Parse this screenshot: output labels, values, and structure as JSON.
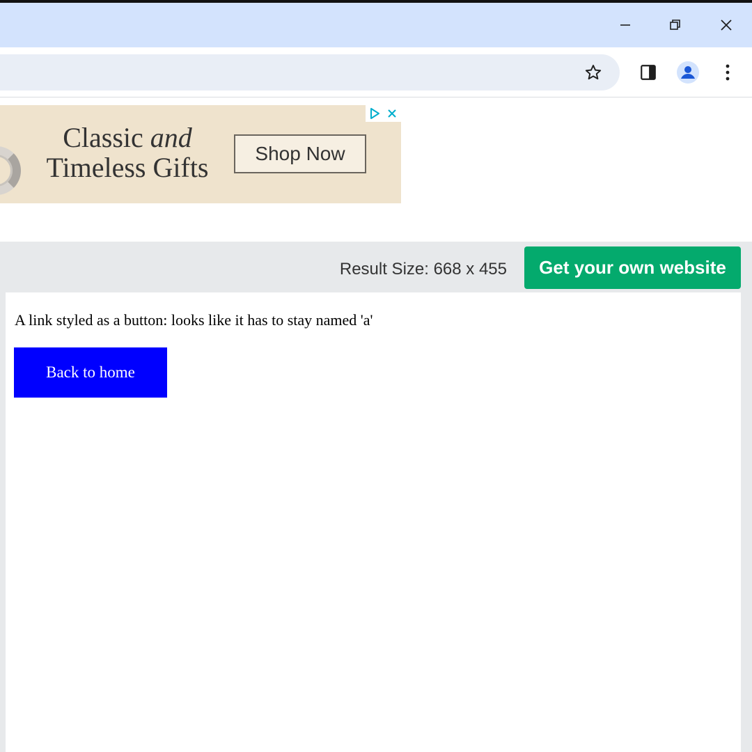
{
  "browser": {
    "window_controls": {
      "minimize_icon": "minimize-icon",
      "restore_icon": "restore-icon",
      "close_icon": "close-icon"
    },
    "toolbar_icons": [
      "star-icon",
      "side-panel-icon",
      "profile-avatar-icon",
      "more-vert-icon"
    ],
    "colors": {
      "titlebar": "#d3e3fd",
      "omnibox": "#e9eef6",
      "avatar": "#1a57d6"
    }
  },
  "ad": {
    "headline_part1": "Classic",
    "headline_italic": "and",
    "headline_line2": "Timeless Gifts",
    "cta_label": "Shop Now",
    "choices_icons": [
      "adchoices-icon",
      "ad-close-icon"
    ],
    "colors": {
      "background": "#efe3cd",
      "choices": "#00aecd"
    }
  },
  "tryit": {
    "result_size_label": "Result Size: 668 x 455",
    "own_website_label": "Get your own website",
    "colors": {
      "button": "#04aa6d",
      "header": "#e7e9eb"
    }
  },
  "result": {
    "text": "A link styled as a button: looks like it has to stay named 'a'",
    "link_label": "Back to home",
    "colors": {
      "link_background": "#0000ff",
      "link_text": "#ffffff"
    }
  }
}
